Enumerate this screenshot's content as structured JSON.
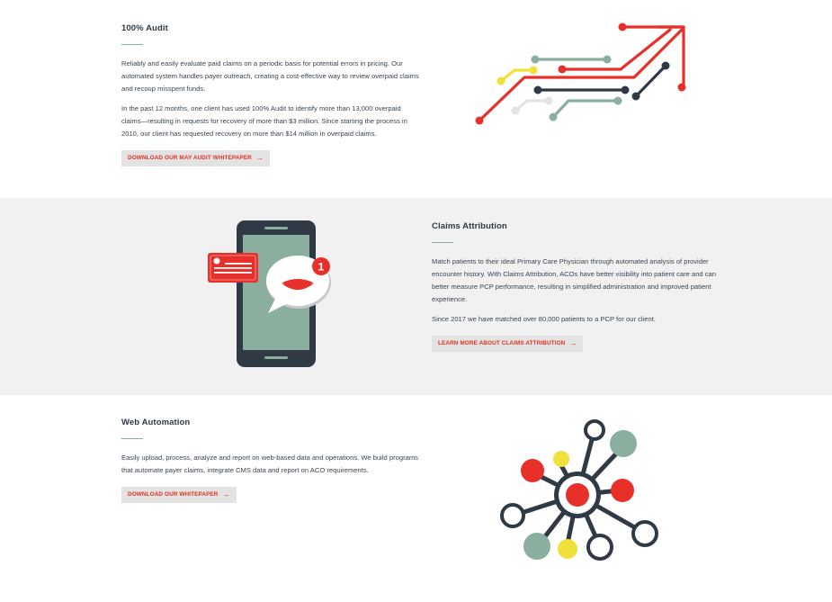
{
  "sections": [
    {
      "title": "100% Audit",
      "paragraphs": [
        "Reliably and easily evaluate paid claims on a periodic basis for potential errors in pricing. Our automated system handles payer outreach, creating a cost-effective way to review overpaid claims and recoup misspent funds.",
        "In the past 12 months, one client has used 100% Audit to identify more than 13,000 overpaid claims—resulting in requests for recovery of more than $3 million. Since starting the process in 2010, our client has requested recovery on more than $14 million in overpaid claims."
      ],
      "button_label": "DOWNLOAD OUR MAY AUDIT WHITEPAPER",
      "icon": "circuit-arrow-icon"
    },
    {
      "title": "Claims Attribution",
      "paragraphs": [
        "Match patients to their ideal Primary Care Physician through automated analysis of provider encounter history. With Claims Attribution, ACOs have better visibility into patient care and can better measure PCP performance, resulting in simplified administration and improved patient experience.",
        "Since 2017 we have matched over 80,000 patients to a PCP for our client."
      ],
      "button_label": "LEARN MORE ABOUT CLAIMS ATTRIBUTION",
      "icon": "phone-notification-icon",
      "notification_count": "1"
    },
    {
      "title": "Web Automation",
      "paragraphs": [
        "Easily upload, process, analyze and report on web-based data and operations. We build programs that automate payer claims, integrate CMS data and report on ACO requirements."
      ],
      "button_label": "DOWNLOAD OUR WHITEPAPER",
      "icon": "network-hub-icon"
    }
  ],
  "colors": {
    "accent_red": "#e8302a",
    "dark": "#2f3a45",
    "sage": "#8aaf9e",
    "yellow": "#f2e03a",
    "light_gray": "#e3e3e3",
    "band_gray": "#f1f1f1"
  }
}
